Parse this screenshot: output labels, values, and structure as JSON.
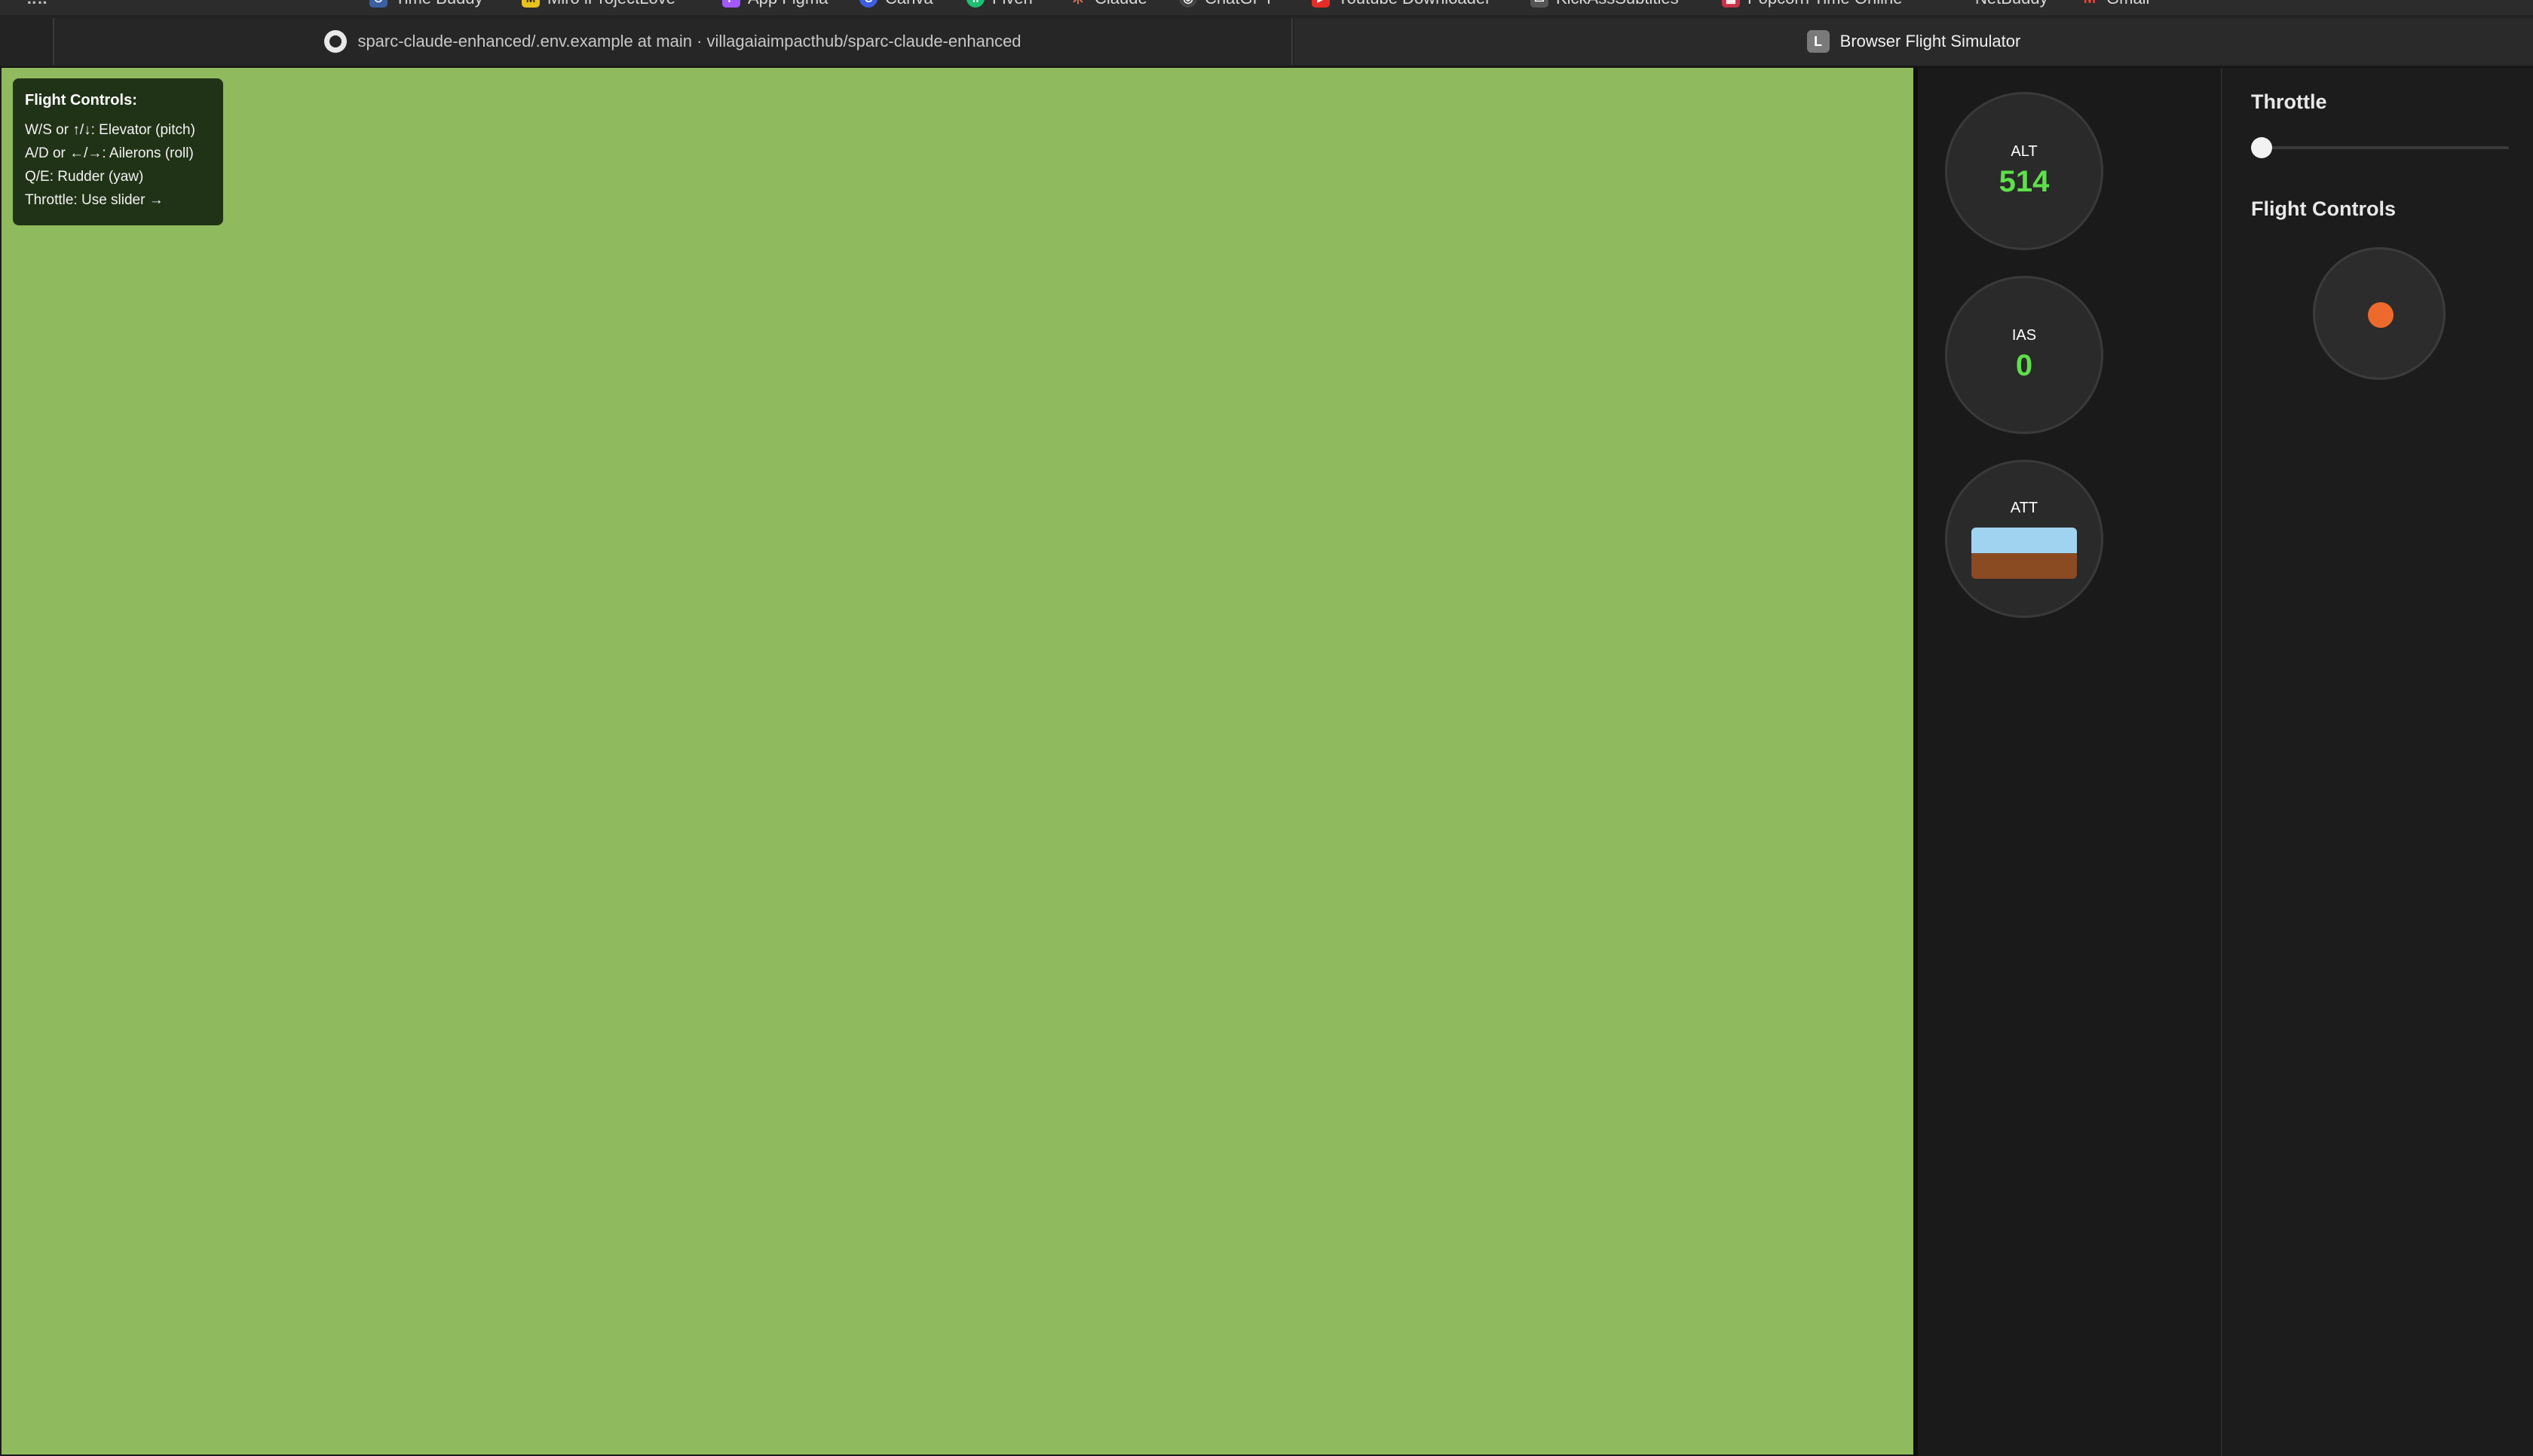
{
  "bookmarks": [
    {
      "label": "Time Buddy",
      "icon": "clock-icon",
      "color": "#3b5fa0",
      "glyph": "⏱"
    },
    {
      "label": "Miro iProjectLove",
      "icon": "miro-icon",
      "color": "#e8c21c",
      "glyph": "M"
    },
    {
      "label": "App Figma",
      "icon": "figma-icon",
      "color": "#a259ff",
      "glyph": "F"
    },
    {
      "label": "Canva",
      "icon": "canva-icon",
      "color": "#3d5ee1",
      "glyph": "C"
    },
    {
      "label": "Fiverr",
      "icon": "fiverr-icon",
      "color": "#1dbf73",
      "glyph": "fi"
    },
    {
      "label": "Claude",
      "icon": "claude-icon",
      "color": "#d97757",
      "glyph": "✳"
    },
    {
      "label": "ChatGPT",
      "icon": "chatgpt-icon",
      "color": "#444444",
      "glyph": "◎"
    },
    {
      "label": "Youtube Downloader",
      "icon": "youtube-icon",
      "color": "#e52d27",
      "glyph": "▶"
    },
    {
      "label": "KickAssSubtitles",
      "icon": "subtitles-icon",
      "color": "#555555",
      "glyph": "▭"
    },
    {
      "label": "Popcorn Time Online",
      "icon": "popcorn-icon",
      "color": "#c8334a",
      "glyph": "▦"
    },
    {
      "label": "NetBuddy",
      "icon": "netbuddy-icon",
      "color": "#2c2c2c",
      "glyph": ""
    },
    {
      "label": "Gmail",
      "icon": "gmail-icon",
      "color": "#ea4335",
      "glyph": "M"
    }
  ],
  "tabs": [
    {
      "label": "sparc-claude-enhanced/.env.example at main · villagaiaimpacthub/sparc-claude-enhanced",
      "icon": "github-icon"
    },
    {
      "label": "Browser Flight Simulator",
      "icon": "letter-l-icon",
      "glyph": "L"
    }
  ],
  "help": {
    "title": "Flight Controls:",
    "lines": [
      "W/S or ↑/↓: Elevator (pitch)",
      "A/D or ←/→: Ailerons (roll)",
      "Q/E: Rudder (yaw)",
      "Throttle: Use slider →"
    ]
  },
  "instruments": {
    "alt": {
      "label": "ALT",
      "value": "514"
    },
    "ias": {
      "label": "IAS",
      "value": "0"
    },
    "att": {
      "label": "ATT"
    }
  },
  "controls": {
    "throttle_label": "Throttle",
    "throttle_value": 0,
    "flight_controls_label": "Flight Controls"
  },
  "colors": {
    "terrain": "#8fba5d",
    "gauge_value": "#5ee04a",
    "joystick_knob": "#ee6a2c",
    "sky": "#9fd3ef",
    "ground": "#8a4a22"
  }
}
